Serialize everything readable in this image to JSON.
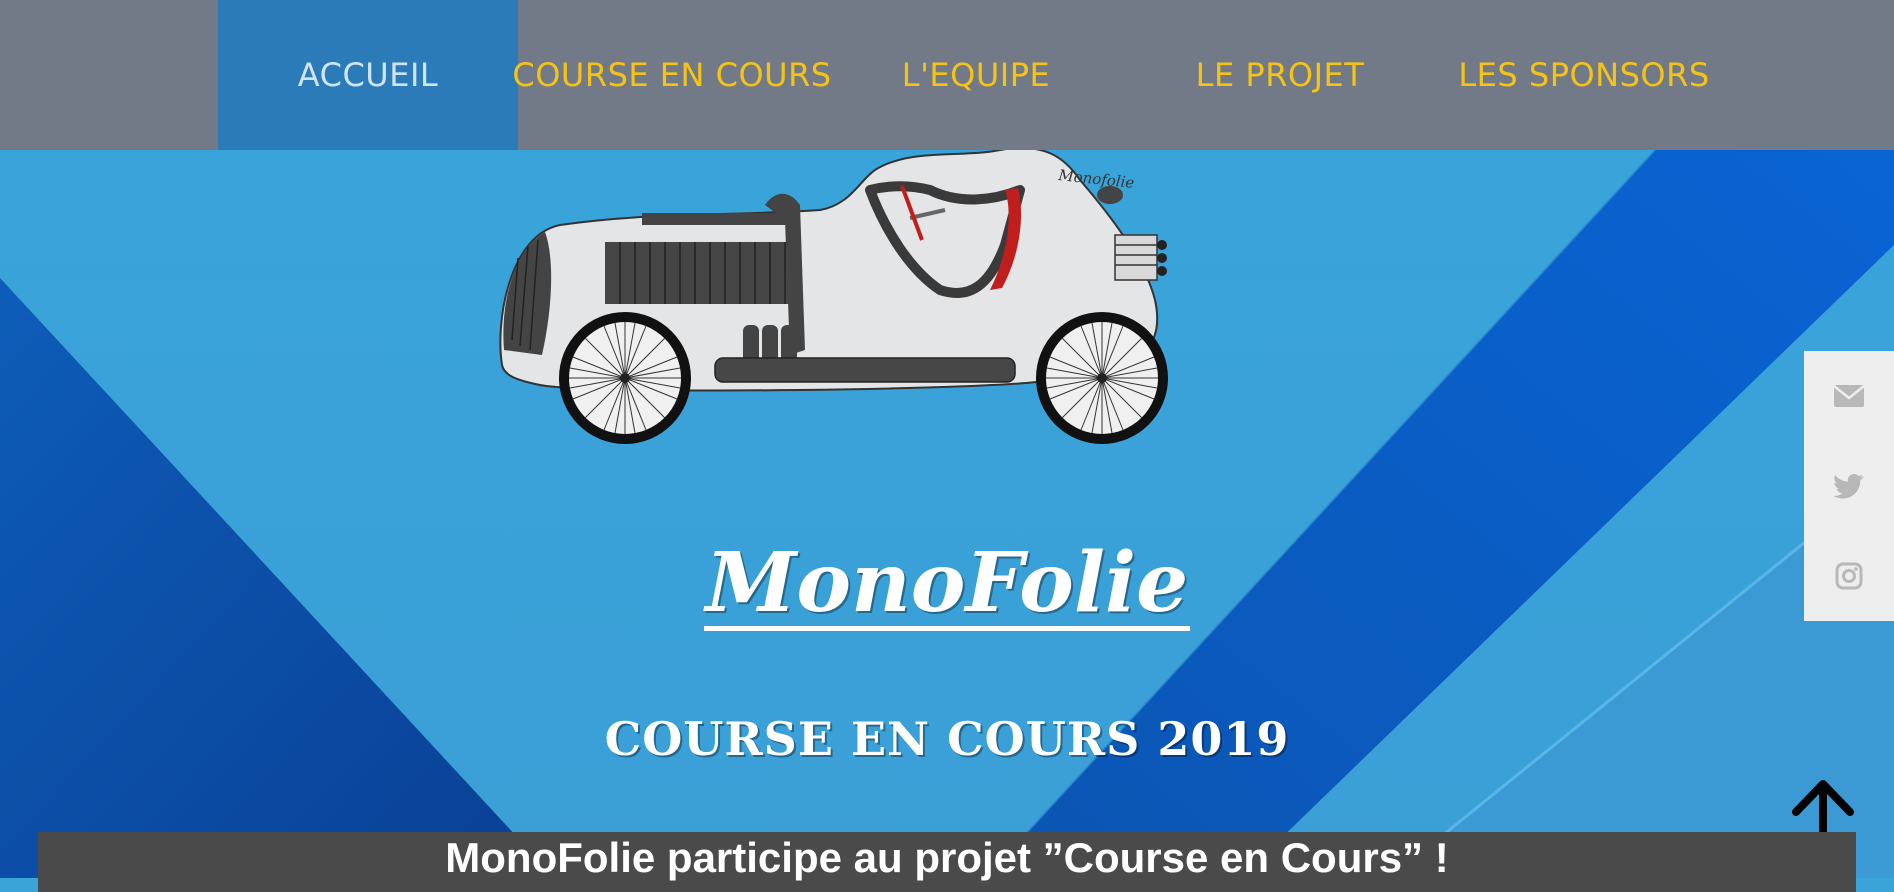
{
  "nav": {
    "items": [
      {
        "label": "ACCUEIL"
      },
      {
        "label": "COURSE EN COURS"
      },
      {
        "label": "L'EQUIPE"
      },
      {
        "label": "LE PROJET"
      },
      {
        "label": "LES SPONSORS"
      }
    ],
    "active_index": 0
  },
  "hero": {
    "car_badge": "Monofolie",
    "brand": "MonoFolie",
    "subtitle": "COURSE EN COURS 2019"
  },
  "social": {
    "items": [
      {
        "icon": "envelope-icon"
      },
      {
        "icon": "twitter-icon"
      },
      {
        "icon": "instagram-icon"
      }
    ]
  },
  "back_to_top": {
    "icon": "arrow-up-icon"
  },
  "banner": {
    "text": "MonoFolie participe au projet ”Course en Cours” !"
  },
  "colors": {
    "nav_background": "#727a87",
    "nav_active": "#2b7bb9",
    "nav_text": "#f5c318",
    "hero_light_blue": "#3aa3d8",
    "hero_dark_blue": "#0a56b4",
    "banner_background": "#4a4a4a"
  }
}
